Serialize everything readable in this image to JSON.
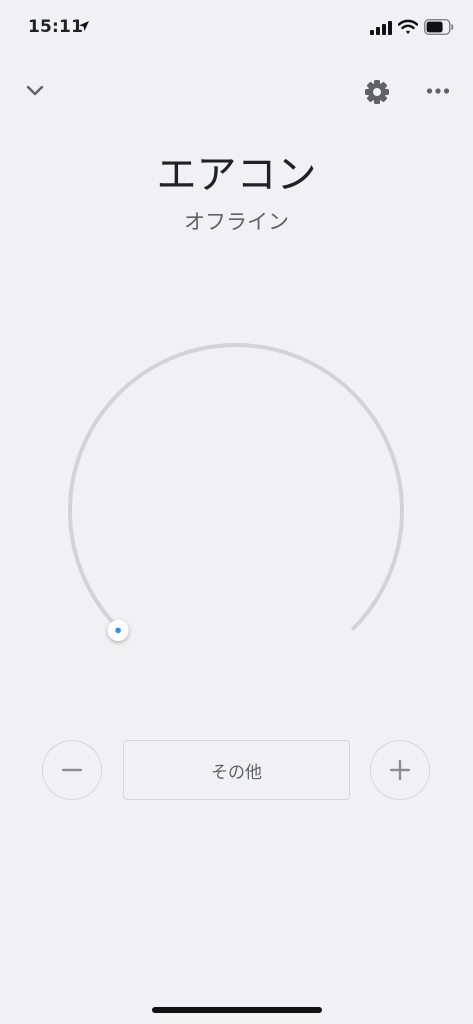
{
  "status_bar": {
    "time": "15:11",
    "icons": [
      "location-arrow-icon",
      "signal-icon",
      "wifi-icon",
      "battery-icon"
    ],
    "battery_level": 0.75
  },
  "header": {
    "back_icon": "chevron-down-icon",
    "settings_icon": "gear-icon",
    "more_icon": "more-horizontal-icon"
  },
  "device": {
    "name": "エアコン",
    "status": "オフライン"
  },
  "dial": {
    "arc_color": "#d3d3d5",
    "thumb_dot_color": "#4285f4",
    "level": 0
  },
  "controls": {
    "minus_icon": "minus-icon",
    "mode_label": "その他",
    "plus_icon": "plus-icon"
  },
  "colors": {
    "background": "#f1f1f3",
    "text_primary": "#202124",
    "text_secondary": "#5f6368",
    "icon": "#5f6368",
    "border": "#d6d6d8"
  }
}
